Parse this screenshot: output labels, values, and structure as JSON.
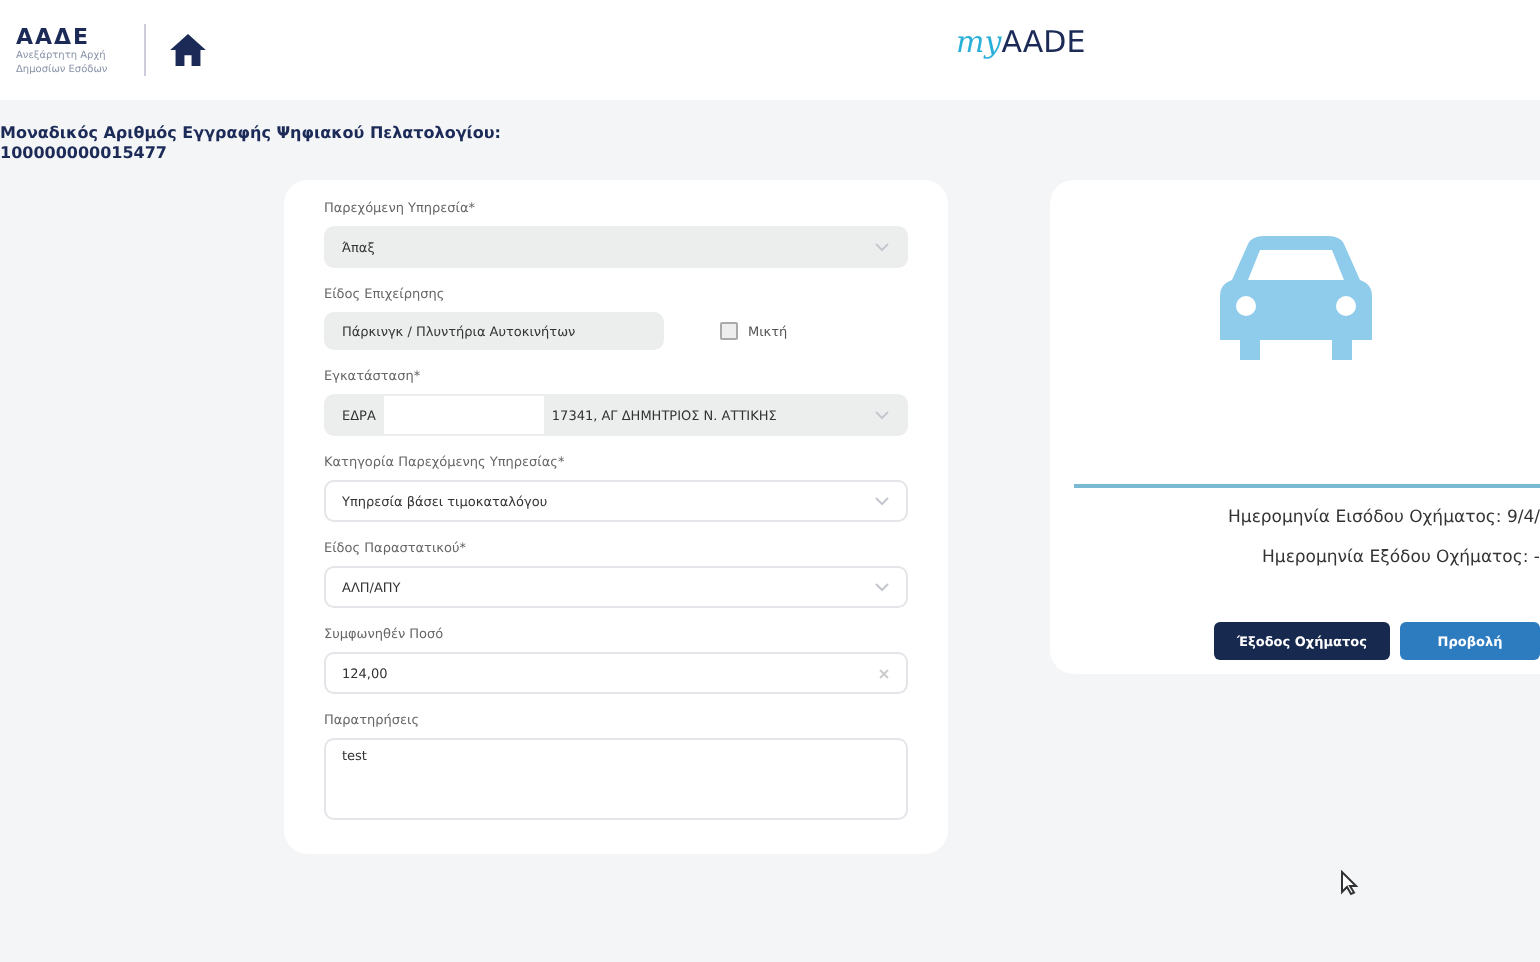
{
  "header": {
    "logo_title": "ΑΑΔΕ",
    "logo_subtitle": "Ανεξάρτητη Αρχή Δημοσίων Εσόδων",
    "brand_prefix": "my",
    "brand_name": "AADE"
  },
  "registry": {
    "label": "Μοναδικός Αριθμός Εγγραφής Ψηφιακού Πελατολογίου:",
    "number": "100000000015477"
  },
  "form": [
    {
      "kind": "select",
      "label": "Παρεχόμενη Υπηρεσία*",
      "value": "Άπαξ",
      "disabled": true
    },
    {
      "kind": "text",
      "label": "Είδος Επιχείρησης",
      "value": "Πάρκινγκ / Πλυντήρια Αυτοκινήτων",
      "disabled": true,
      "checkbox": {
        "label": "Μικτή",
        "checked": false
      }
    },
    {
      "kind": "select",
      "label": "Εγκατάσταση*",
      "value": "ΕΔΡΑ",
      "value_2": "17341, ΑΓ ΔΗΜΗΤΡΙΟΣ Ν. ΑΤΤΙΚΗΣ",
      "disabled": true
    },
    {
      "kind": "select",
      "label": "Κατηγορία Παρεχόμενης Υπηρεσίας*",
      "value": "Υπηρεσία βάσει τιμοκαταλόγου",
      "disabled": false
    },
    {
      "kind": "select",
      "label": "Είδος Παραστατικού*",
      "value": "ΑΛΠ/ΑΠΥ",
      "disabled": false
    },
    {
      "kind": "clearable",
      "label": "Συμφωνηθέν Ποσό",
      "value": "124,00",
      "disabled": false
    },
    {
      "kind": "textarea",
      "label": "Παρατηρήσεις",
      "value": "test",
      "disabled": false
    }
  ],
  "vehicle": {
    "entry": "Ημερομηνία Εισόδου Οχήματος: 9/4/",
    "exit": "Ημερομηνία Εξόδου Οχήματος: -",
    "buttons": [
      {
        "label": "Έξοδος Οχήματος",
        "kind": "dark"
      },
      {
        "label": "Προβολή",
        "kind": "primary"
      }
    ]
  }
}
